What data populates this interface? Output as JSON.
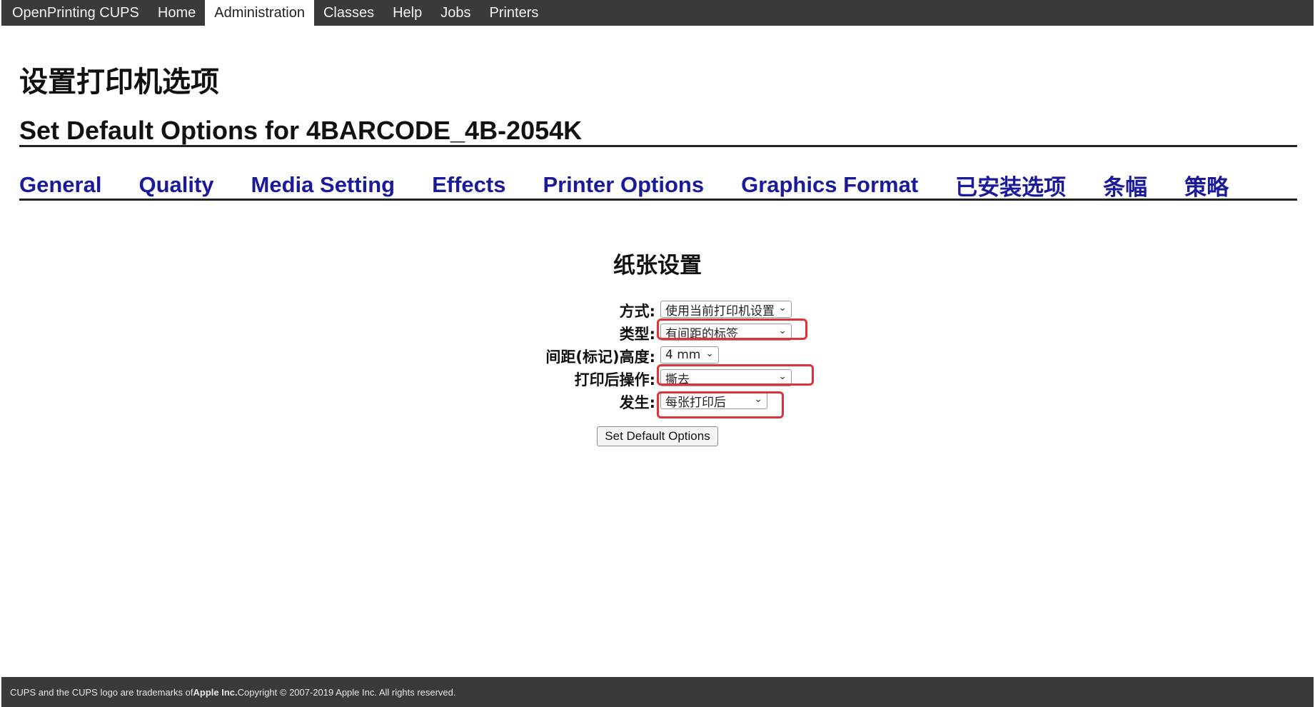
{
  "header": {
    "brand": "OpenPrinting CUPS",
    "items": [
      {
        "label": "Home",
        "active": false
      },
      {
        "label": "Administration",
        "active": true
      },
      {
        "label": "Classes",
        "active": false
      },
      {
        "label": "Help",
        "active": false
      },
      {
        "label": "Jobs",
        "active": false
      },
      {
        "label": "Printers",
        "active": false
      }
    ]
  },
  "page": {
    "title_zh": "设置打印机选项",
    "title_en": "Set Default Options for 4BARCODE_4B-2054K"
  },
  "tabs": [
    "General",
    "Quality",
    "Media Setting",
    "Effects",
    "Printer Options",
    "Graphics Format",
    "已安装选项",
    "条幅",
    "策略"
  ],
  "section": {
    "title": "纸张设置",
    "fields": [
      {
        "label": "方式:",
        "value": "使用当前打印机设置",
        "highlighted": false
      },
      {
        "label": "类型:",
        "value": "有间距的标签",
        "highlighted": true
      },
      {
        "label": "间距(标记)高度:",
        "value": "4 mm",
        "highlighted": false
      },
      {
        "label": "打印后操作:",
        "value": "撕去",
        "highlighted": true
      },
      {
        "label": "发生:",
        "value": "每张打印后",
        "highlighted": true
      }
    ],
    "submit_label": "Set Default Options"
  },
  "footer": {
    "text_before": "CUPS and the CUPS logo are trademarks of ",
    "company": "Apple Inc.",
    "text_after": " Copyright © 2007-2019 Apple Inc. All rights reserved."
  },
  "colors": {
    "header_bg": "#3a3a3a",
    "tab_link": "#1a1a9a",
    "highlight": "#e0313a"
  }
}
